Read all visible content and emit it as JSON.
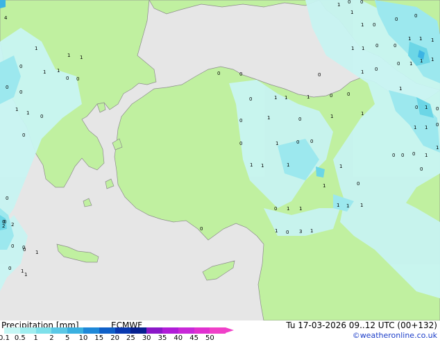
{
  "footer": {
    "title": "Precipitation [mm]",
    "model": "ECMWF",
    "valid_time": "Tu 17-03-2026 09..12 UTC (00+132)",
    "credit": "©weatheronline.co.uk"
  },
  "legend": {
    "ticks": [
      "0.1",
      "0.5",
      "1",
      "2",
      "5",
      "10",
      "15",
      "20",
      "25",
      "30",
      "35",
      "40",
      "45",
      "50"
    ],
    "colors": [
      "#c6f7f5",
      "#a0eef0",
      "#7ee0ea",
      "#5bc8e6",
      "#3ab0e0",
      "#1e88d8",
      "#1060c8",
      "#0838b0",
      "#062090",
      "#8a18c8",
      "#b01cd8",
      "#c828d8",
      "#e030d0",
      "#f040c8"
    ]
  },
  "map": {
    "colors": {
      "sea": "#e6e6e6",
      "land": "#c0f0a0",
      "precip_light": "#c8f4f2",
      "precip_mid": "#9ce8ee",
      "precip_heavy": "#6cd6e6",
      "precip_max": "#3cb4e4",
      "coast": "#8c8c8c"
    },
    "values": [
      "4",
      "1",
      "1",
      "1",
      "0",
      "0",
      "1",
      "1",
      "0",
      "0",
      "1",
      "0",
      "0",
      "1",
      "0",
      "0",
      "0",
      "0",
      "0",
      "1",
      "0",
      "1",
      "0",
      "0",
      "0",
      "1",
      "1",
      "1",
      "0",
      "0",
      "0",
      "1",
      "0",
      "1",
      "1",
      "0",
      "1",
      "0",
      "0",
      "1",
      "1",
      "1",
      "0",
      "1",
      "0",
      "0",
      "1",
      "0",
      "1",
      "0",
      "1",
      "0",
      "0",
      "1",
      "1",
      "0",
      "0",
      "1",
      "1",
      "1",
      "0",
      "1",
      "1",
      "1",
      "0",
      "1",
      "0",
      "1",
      "1",
      "1",
      "0",
      "0",
      "0",
      "0",
      "1",
      "1",
      "0",
      "1",
      "0",
      "1",
      "1",
      "1",
      "1",
      "0",
      "1",
      "1",
      "1",
      "0",
      "3",
      "1",
      "0",
      "2",
      "1",
      "2",
      "0",
      "0"
    ]
  }
}
